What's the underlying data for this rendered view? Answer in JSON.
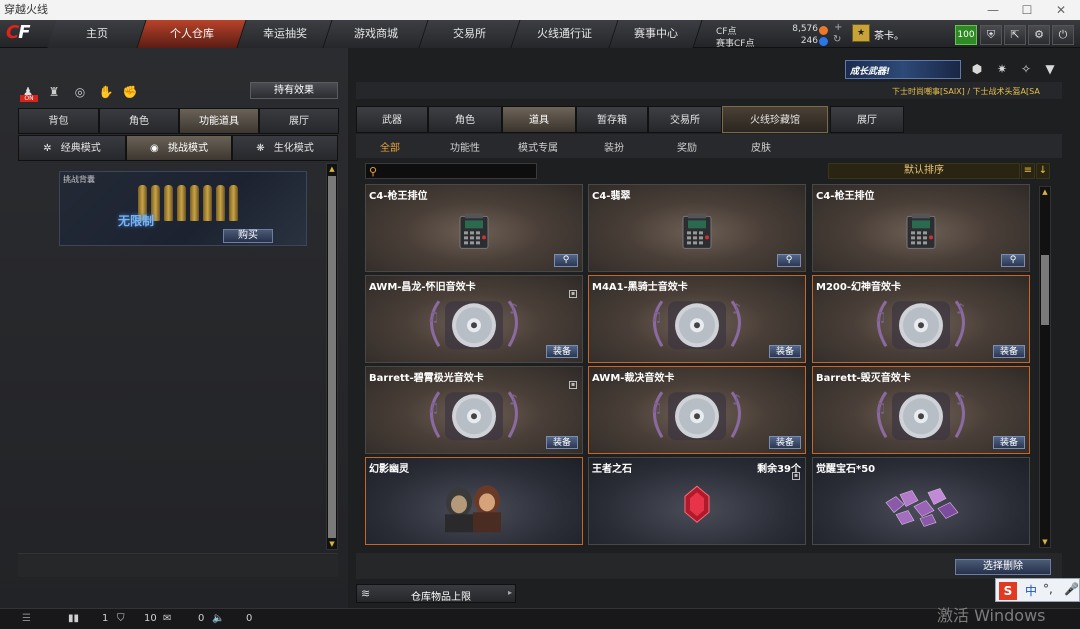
{
  "window": {
    "title": "穿越火线"
  },
  "nav": {
    "tabs": [
      {
        "label": "主页"
      },
      {
        "label": "个人仓库",
        "active": true
      },
      {
        "label": "幸运抽奖"
      },
      {
        "label": "游戏商城"
      },
      {
        "label": "交易所"
      },
      {
        "label": "火线通行证"
      },
      {
        "label": "赛事中心"
      }
    ]
  },
  "currency": {
    "cf_label": "CF点",
    "cf_value": "8,576",
    "match_label": "赛事CF点",
    "match_value": "246"
  },
  "player": {
    "name": "茶卡。"
  },
  "hud": {
    "hp": "100"
  },
  "left_panel": {
    "effects_button": "持有效果",
    "tabs": [
      "背包",
      "角色",
      "功能道具",
      "展厅"
    ],
    "active_tab": 2,
    "modes": [
      "经典模式",
      "挑战模式",
      "生化模式"
    ],
    "active_mode": 1,
    "featured": {
      "title": "挑战背囊",
      "art_text": "无限制",
      "buy_label": "购买"
    }
  },
  "right_panel": {
    "banner": "成长武器!",
    "ticker": "下士时尚嘲事[SAIX] / 下士战术头盔A[SA",
    "tabs": [
      "武器",
      "角色",
      "道具",
      "暂存箱",
      "交易所",
      "火线珍藏馆",
      "展厅"
    ],
    "active_tab": 2,
    "subtabs": [
      "全部",
      "功能性",
      "模式专属",
      "装扮",
      "奖励",
      "皮肤"
    ],
    "active_subtab": 0,
    "search": {
      "placeholder": ""
    },
    "sort_label": "默认排序",
    "items": [
      {
        "name": "C4-枪王排位",
        "kind": "c4",
        "action": "zoom",
        "highlight": false
      },
      {
        "name": "C4-翡翠",
        "kind": "c4",
        "action": "zoom",
        "highlight": false
      },
      {
        "name": "C4-枪王排位",
        "kind": "c4",
        "action": "zoom",
        "highlight": false
      },
      {
        "name": "AWM-昌龙-怀旧音效卡",
        "kind": "disc",
        "action": "装备",
        "highlight": false,
        "lock": true
      },
      {
        "name": "M4A1-黑骑士音效卡",
        "kind": "disc",
        "action": "装备",
        "highlight": true
      },
      {
        "name": "M200-幻神音效卡",
        "kind": "disc",
        "action": "装备",
        "highlight": true
      },
      {
        "name": "Barrett-碧霄极光音效卡",
        "kind": "disc",
        "action": "装备",
        "highlight": false,
        "lock": true
      },
      {
        "name": "AWM-裁决音效卡",
        "kind": "disc",
        "action": "装备",
        "highlight": true
      },
      {
        "name": "Barrett-毁灭音效卡",
        "kind": "disc",
        "action": "装备",
        "highlight": true
      },
      {
        "name": "幻影幽灵",
        "kind": "ghost",
        "action": "",
        "highlight": true
      },
      {
        "name": "王者之石",
        "kind": "gem",
        "action": "",
        "highlight": false,
        "extra": "剩余39个",
        "lock": true
      },
      {
        "name": "觉醒宝石*50",
        "kind": "gems",
        "action": "",
        "highlight": false
      }
    ],
    "delete_label": "选择删除",
    "capacity_label": "仓库物品上限"
  },
  "status_bar": {
    "v1": "1",
    "v2": "10",
    "v3": "0",
    "v4": "0"
  },
  "overlay": {
    "ime_chinese": "中",
    "ime_dot": "°,",
    "watermark": "激活 Windows"
  }
}
